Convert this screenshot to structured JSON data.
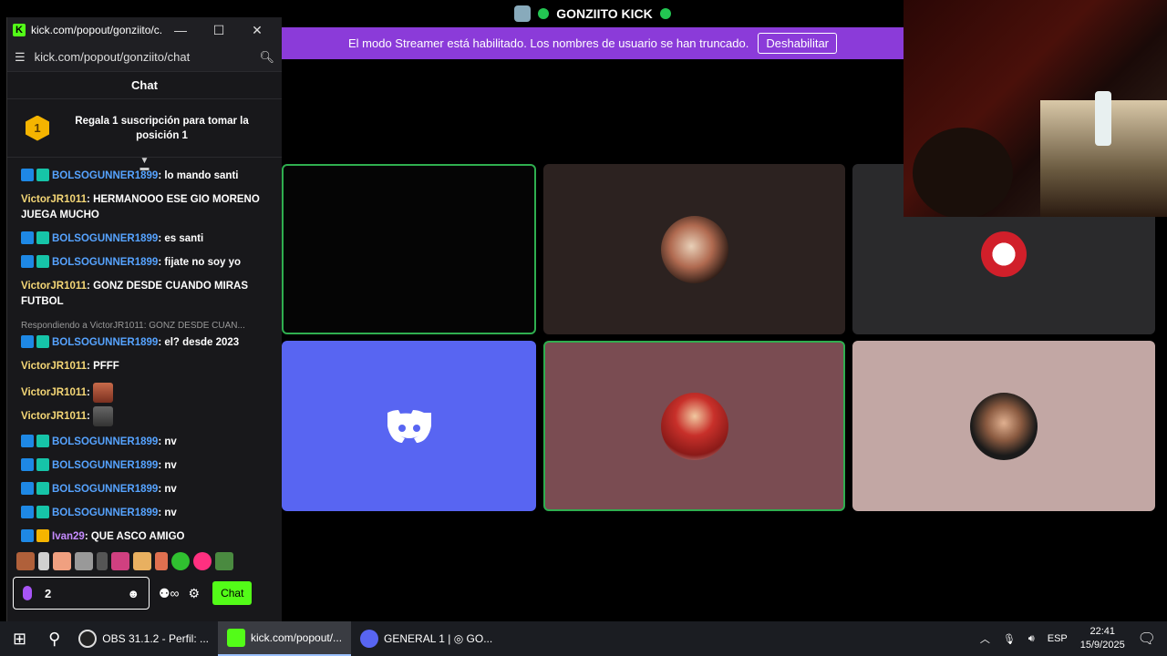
{
  "stage": {
    "title": "GONZIITO KICK",
    "banner_text": "El modo Streamer está habilitado. Los nombres de usuario se han truncado.",
    "banner_button": "Deshabilitar"
  },
  "browser": {
    "window_title": "kick.com/popout/gonziito/c...",
    "url": "kick.com/popout/gonziito/chat",
    "chat_header": "Chat",
    "promo_badge": "1",
    "promo_text": "Regala 1 suscripción para tomar la posición 1",
    "messages": [
      {
        "user": "BOLSOGUNNER1899",
        "text": ": lo mando santi"
      },
      {
        "user": "VictorJR1011",
        "text": ": HERMANOOO ESE GIO MORENO JUEGA MUCHO"
      },
      {
        "user": "BOLSOGUNNER1899",
        "text": ": es santi"
      },
      {
        "user": "BOLSOGUNNER1899",
        "text": ": fijate no soy yo"
      },
      {
        "user": "VictorJR1011",
        "text": ": GONZ DESDE CUANDO MIRAS FUTBOL"
      },
      {
        "reply": "Respondiendo a VictorJR1011: GONZ DESDE CUAN...",
        "user": "BOLSOGUNNER1899",
        "text": ": el? desde 2023"
      },
      {
        "user": "VictorJR1011",
        "text": ": PFFF"
      },
      {
        "user": "VictorJR1011",
        "text": ":"
      },
      {
        "user": "VictorJR1011",
        "text": ":"
      },
      {
        "user": "BOLSOGUNNER1899",
        "text": ": nv"
      },
      {
        "user": "BOLSOGUNNER1899",
        "text": ": nv"
      },
      {
        "user": "BOLSOGUNNER1899",
        "text": ": nv"
      },
      {
        "user": "BOLSOGUNNER1899",
        "text": ": nv"
      },
      {
        "user": "Ivan29",
        "text": ": QUE ASCO AMIGO"
      }
    ],
    "input_value": "2",
    "chat_button": "Chat"
  },
  "taskbar": {
    "items": [
      {
        "label": "OBS 31.1.2 - Perfil: ..."
      },
      {
        "label": "kick.com/popout/..."
      },
      {
        "label": "GENERAL 1 | ◎ GO..."
      }
    ],
    "lang": "ESP",
    "time": "22:41",
    "date": "15/9/2025"
  }
}
